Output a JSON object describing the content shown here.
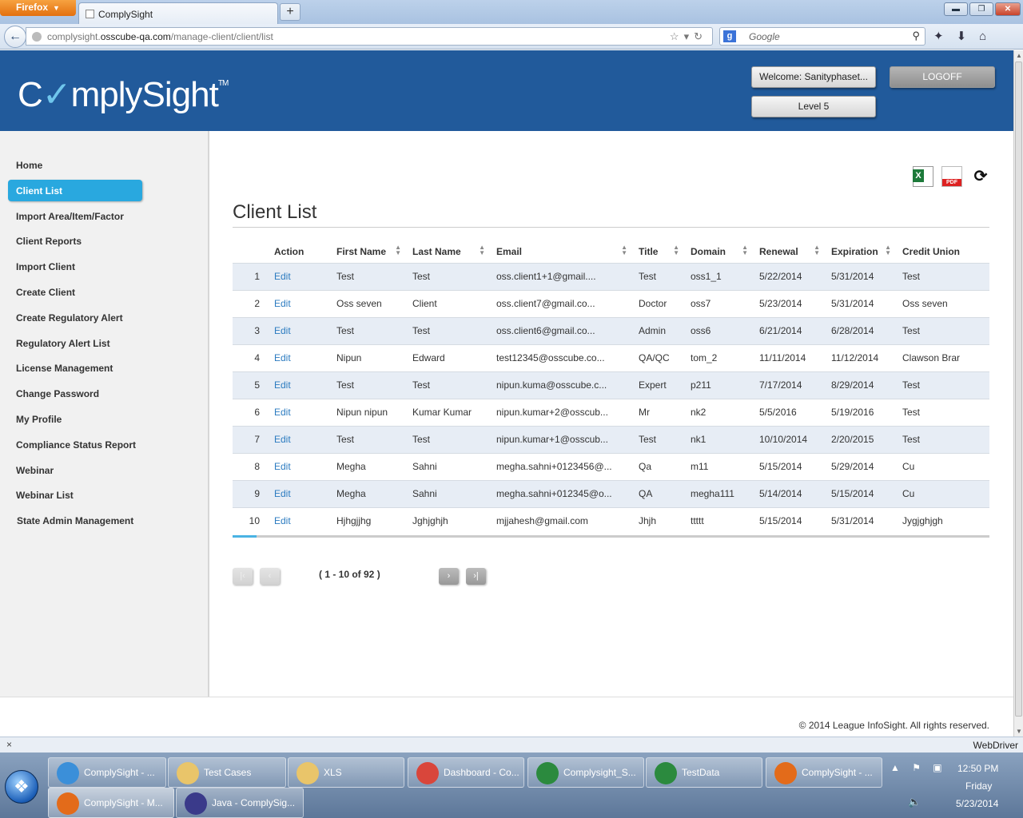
{
  "browser": {
    "menu_button": "Firefox",
    "tab_title": "ComplySight",
    "new_tab": "+",
    "url_prefix": "complysight.",
    "url_domain": "osscube-qa.com",
    "url_path": "/manage-client/client/list",
    "search_placeholder": "Google"
  },
  "header": {
    "logo_text_1": "C",
    "logo_check": "✓",
    "logo_text_2": "mplySight",
    "logo_tm": "TM",
    "welcome": "Welcome: Sanityphaset...",
    "logoff": "LOGOFF",
    "level": "Level 5"
  },
  "sidebar": {
    "items": [
      {
        "label": "Home"
      },
      {
        "label": "Client List",
        "active": true
      },
      {
        "label": "Import Area/Item/Factor"
      },
      {
        "label": "Client Reports"
      },
      {
        "label": "Import Client"
      },
      {
        "label": "Create Client"
      },
      {
        "label": "Create Regulatory Alert"
      },
      {
        "label": "Regulatory Alert List"
      },
      {
        "label": "License Management"
      },
      {
        "label": "Change Password"
      },
      {
        "label": "My Profile"
      },
      {
        "label": "Compliance Status Report"
      },
      {
        "label": "Webinar"
      },
      {
        "label": "Webinar List"
      },
      {
        "label": "State Admin Management"
      }
    ]
  },
  "main": {
    "title": "Client List",
    "columns": [
      "",
      "Action",
      "First Name",
      "Last Name",
      "Email",
      "Title",
      "Domain",
      "Renewal",
      "Expiration",
      "Credit Union"
    ],
    "rows": [
      [
        "1",
        "Edit",
        "Test",
        "Test",
        "oss.client1+1@gmail....",
        "Test",
        "oss1_1",
        "5/22/2014",
        "5/31/2014",
        "Test"
      ],
      [
        "2",
        "Edit",
        "Oss seven",
        "Client",
        "oss.client7@gmail.co...",
        "Doctor",
        "oss7",
        "5/23/2014",
        "5/31/2014",
        "Oss seven"
      ],
      [
        "3",
        "Edit",
        "Test",
        "Test",
        "oss.client6@gmail.co...",
        "Admin",
        "oss6",
        "6/21/2014",
        "6/28/2014",
        "Test"
      ],
      [
        "4",
        "Edit",
        "Nipun",
        "Edward",
        "test12345@osscube.co...",
        "QA/QC",
        "tom_2",
        "11/11/2014",
        "11/12/2014",
        "Clawson Brar"
      ],
      [
        "5",
        "Edit",
        "Test",
        "Test",
        "nipun.kuma@osscube.c...",
        "Expert",
        "p211",
        "7/17/2014",
        "8/29/2014",
        "Test"
      ],
      [
        "6",
        "Edit",
        "Nipun nipun",
        "Kumar Kumar",
        "nipun.kumar+2@osscub...",
        "Mr",
        "nk2",
        "5/5/2016",
        "5/19/2016",
        "Test"
      ],
      [
        "7",
        "Edit",
        "Test",
        "Test",
        "nipun.kumar+1@osscub...",
        "Test",
        "nk1",
        "10/10/2014",
        "2/20/2015",
        "Test"
      ],
      [
        "8",
        "Edit",
        "Megha",
        "Sahni",
        "megha.sahni+0123456@...",
        "Qa",
        "m11",
        "5/15/2014",
        "5/29/2014",
        "Cu"
      ],
      [
        "9",
        "Edit",
        "Megha",
        "Sahni",
        "megha.sahni+012345@o...",
        "QA",
        "megha111",
        "5/14/2014",
        "5/15/2014",
        "Cu"
      ],
      [
        "10",
        "Edit",
        "Hjhgjjhg",
        "Jghjghjh",
        "mjjahesh@gmail.com",
        "Jhjh",
        "ttttt",
        "5/15/2014",
        "5/31/2014",
        "Jygjghjgh"
      ]
    ],
    "pager_info": "( 1 - 10 of 92 )",
    "pager_first": "|‹",
    "pager_prev": "‹",
    "pager_next": "›",
    "pager_last": "›|"
  },
  "footer": {
    "copyright": "© 2014 League InfoSight. All rights reserved."
  },
  "statusbar": {
    "close": "×",
    "right": "WebDriver"
  },
  "taskbar": {
    "tasks": [
      {
        "label": "ComplySight - ...",
        "icon": "ie-icon",
        "color": "#3b8fd9"
      },
      {
        "label": "Test Cases",
        "icon": "folder-icon",
        "color": "#e9c56a"
      },
      {
        "label": "XLS",
        "icon": "folder-icon",
        "color": "#e9c56a"
      },
      {
        "label": "Dashboard - Co...",
        "icon": "chrome-icon",
        "color": "#d9463b"
      },
      {
        "label": "Complysight_S...",
        "icon": "excel-icon",
        "color": "#2b8a3e"
      },
      {
        "label": "TestData",
        "icon": "excel-icon",
        "color": "#2b8a3e"
      },
      {
        "label": "ComplySight - ...",
        "icon": "firefox-icon",
        "color": "#e36b1a"
      },
      {
        "label": "ComplySight - M...",
        "icon": "firefox-icon",
        "color": "#e36b1a"
      },
      {
        "label": "Java - ComplySig...",
        "icon": "eclipse-icon",
        "color": "#3a3a8a"
      }
    ],
    "time": "12:50 PM",
    "day": "Friday",
    "date": "5/23/2014"
  }
}
